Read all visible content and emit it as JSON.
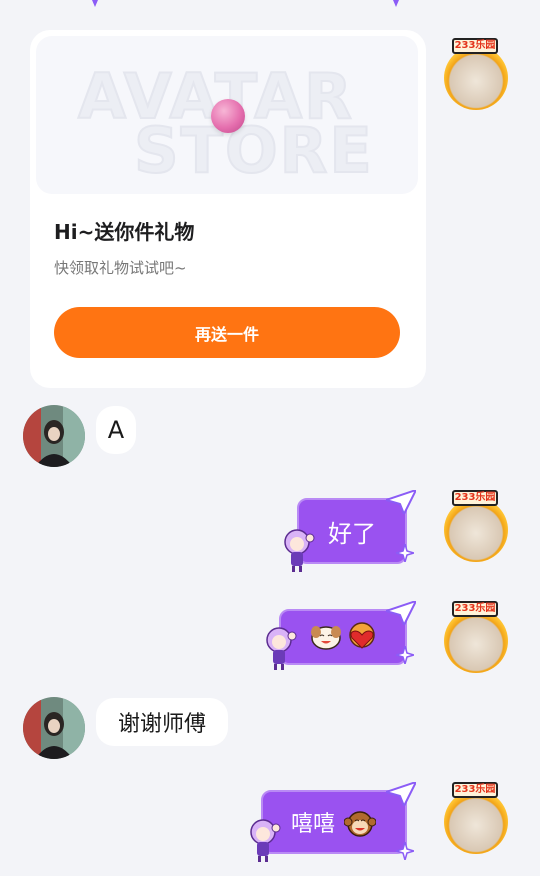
{
  "gift_card": {
    "banner_word_1": "AVATAR",
    "banner_word_2": "STORE",
    "title": "Hi~送你件礼物",
    "subtitle": "快领取礼物试试吧~",
    "button_label": "再送一件"
  },
  "self_avatar_badge": "233乐园",
  "messages": [
    {
      "side": "in",
      "text": "A"
    },
    {
      "side": "out",
      "text": "好了"
    },
    {
      "side": "out",
      "text": ""
    },
    {
      "side": "in",
      "text": "谢谢师傅"
    },
    {
      "side": "out",
      "text": "嘻嘻"
    }
  ],
  "colors": {
    "background": "#f3f4f8",
    "accent_orange": "#ff7412",
    "bubble_purple": "#9a52f0"
  }
}
